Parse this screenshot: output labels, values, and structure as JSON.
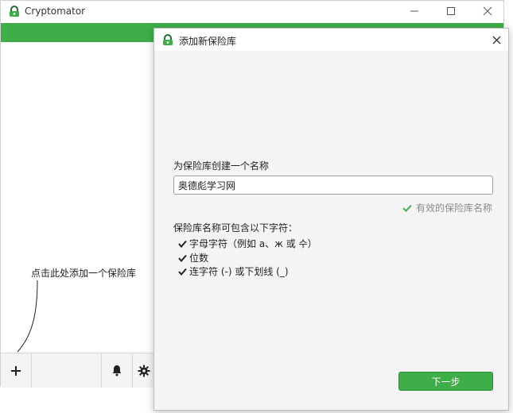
{
  "main_window": {
    "title": "Cryptomator",
    "hint": "点击此处添加一个保险库",
    "footer": {
      "add_icon": "plus-icon",
      "notification_icon": "bell-icon",
      "settings_icon": "gear-icon"
    }
  },
  "dialog": {
    "title": "添加新保险库",
    "name_prompt": "为保险库创建一个名称",
    "vault_name_value": "奥德彪学习网",
    "valid_message": "有效的保险库名称",
    "rules_heading": "保险库名称可包含以下字符：",
    "rules": [
      "字母字符（例如 a、ж 或 수）",
      "位数",
      "连字符 (-) 或下划线 (_)"
    ],
    "next_label": "下一步"
  },
  "colors": {
    "accent_green": "#3eae49",
    "valid_check": "#3eae49"
  }
}
